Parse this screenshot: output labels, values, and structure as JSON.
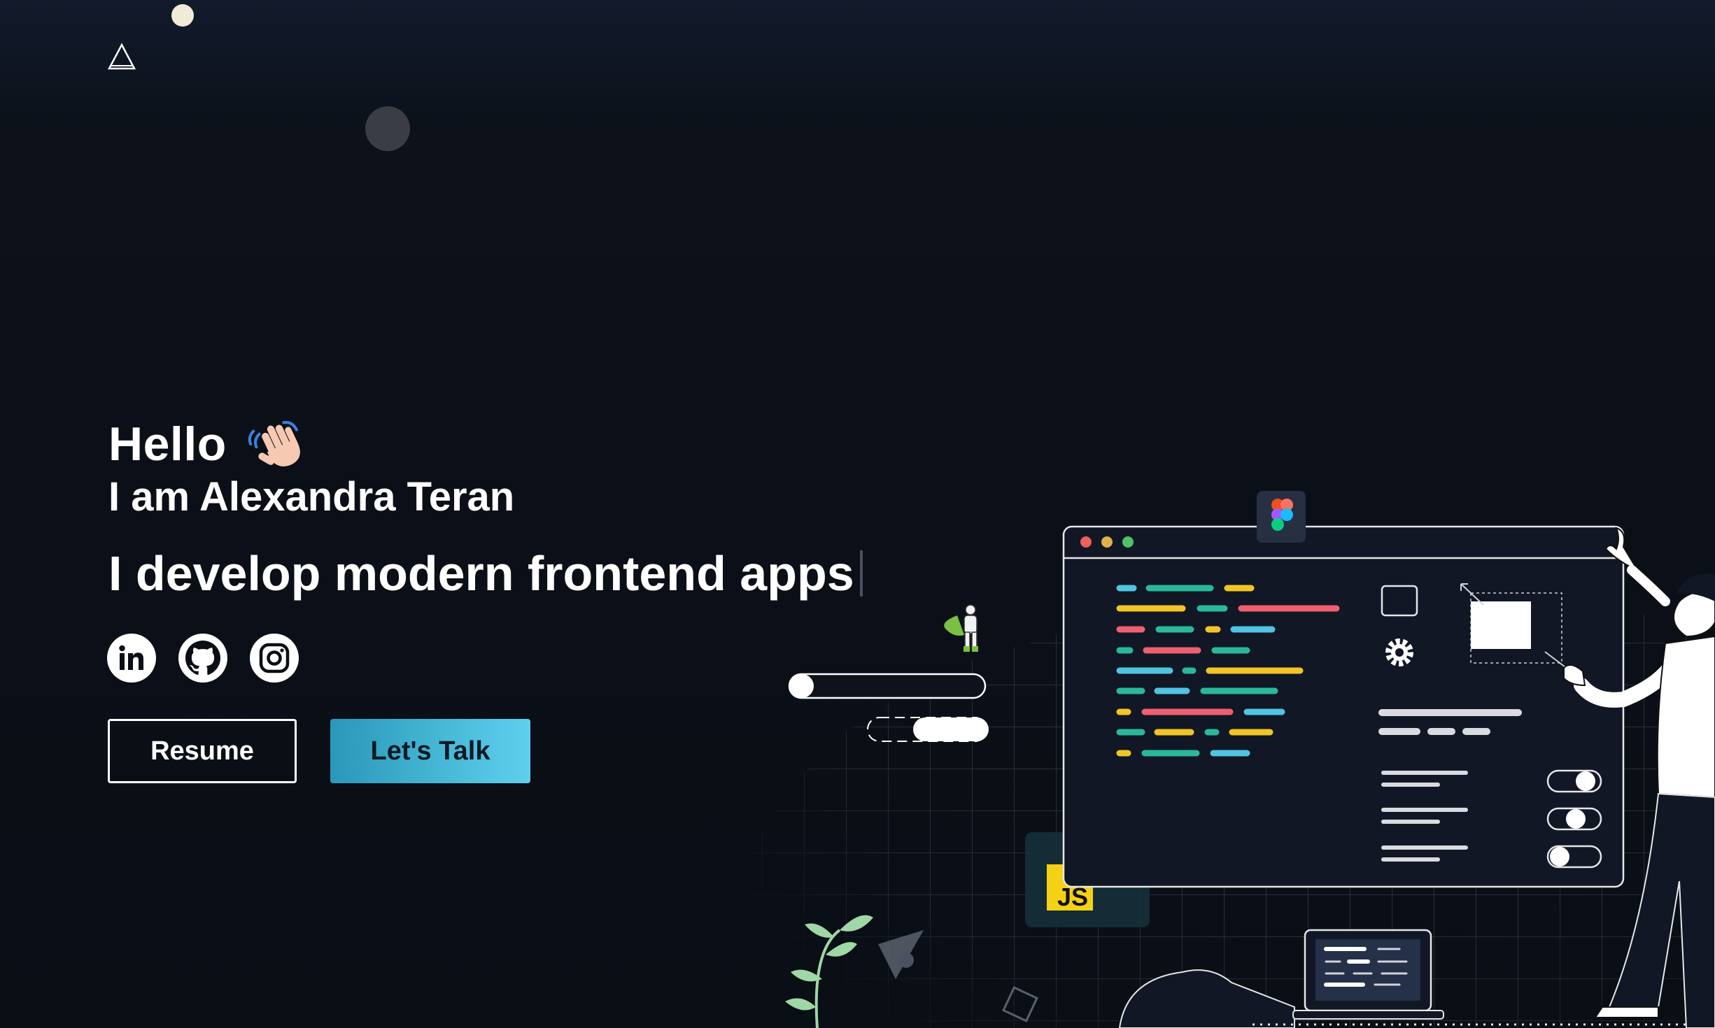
{
  "header": {
    "logo_icon": "triangle-logo-icon"
  },
  "hero": {
    "greeting": "Hello",
    "greeting_icon": "waving-hand-icon",
    "name_line": "I am Alexandra Teran",
    "tagline": "I develop modern frontend apps"
  },
  "socials": [
    {
      "icon": "linkedin-icon"
    },
    {
      "icon": "github-icon"
    },
    {
      "icon": "instagram-icon"
    }
  ],
  "actions": {
    "resume_label": "Resume",
    "talk_label": "Let's Talk"
  },
  "illustration": {
    "badge_js": "JS",
    "icons": [
      "figma-icon",
      "gear-icon",
      "javascript-icon",
      "superhero-icon"
    ]
  },
  "colors": {
    "accent_start": "#2a98b8",
    "accent_end": "#5ed0ee",
    "background": "#0a0e15"
  }
}
